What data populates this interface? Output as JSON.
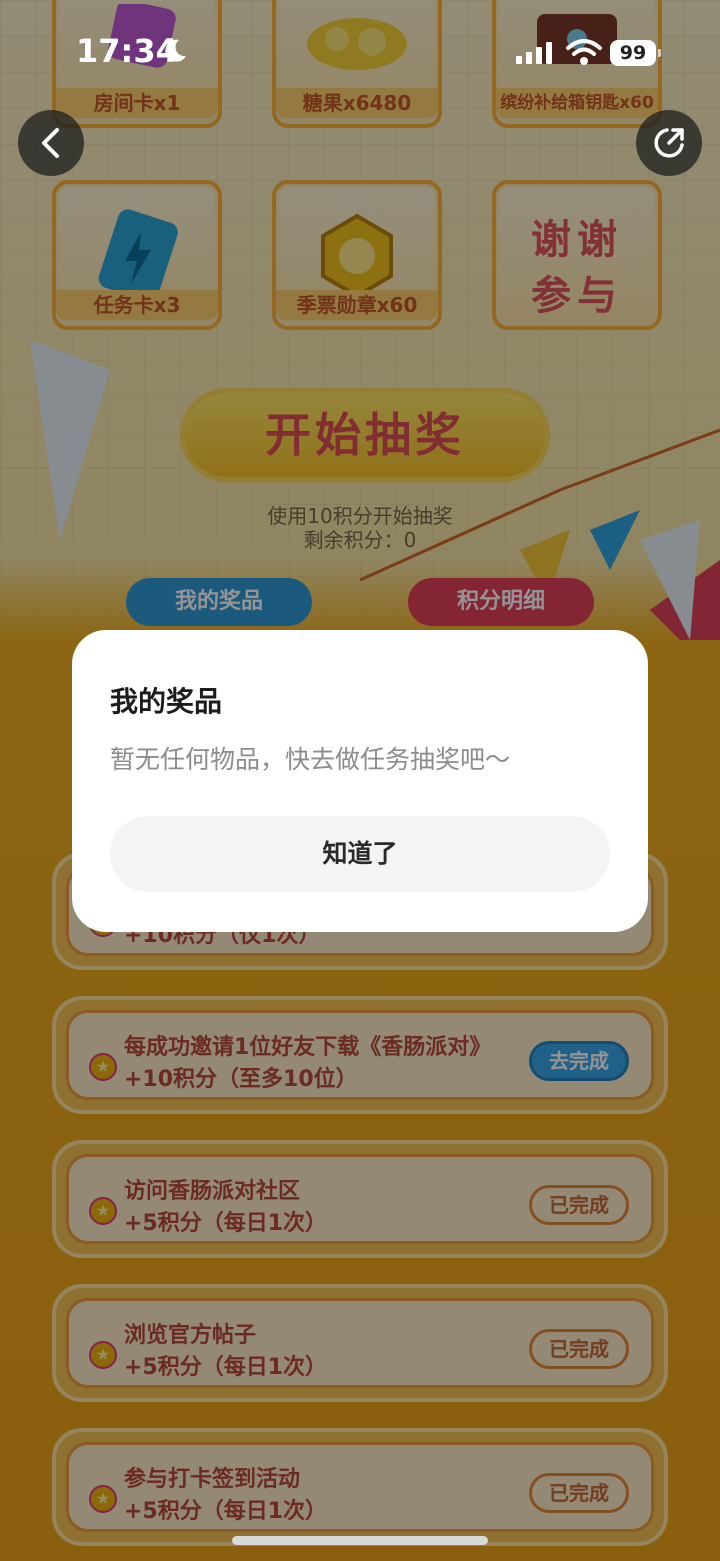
{
  "status_bar": {
    "time": "17:34",
    "battery": "99"
  },
  "prizes": [
    {
      "label": "房间卡x1",
      "icon": "room-card-icon"
    },
    {
      "label": "糖果x6480",
      "icon": "candy-icon"
    },
    {
      "label": "缤纷补给箱钥匙x60",
      "icon": "supply-key-icon"
    },
    {
      "label": "任务卡x3",
      "icon": "task-card-icon"
    },
    {
      "label": "季票勋章x60",
      "icon": "season-medal-icon"
    },
    {
      "label": "谢谢参与",
      "icon": "thanks-text"
    }
  ],
  "draw": {
    "button_label": "开始抽奖",
    "cost_text": "使用10积分开始抽奖",
    "remaining_text": "剩余积分：0"
  },
  "tabs": {
    "my_prizes": "我的奖品",
    "points_detail": "积分明细"
  },
  "tasks": [
    {
      "title": "",
      "points": "+10积分（仅1次）",
      "action": ""
    },
    {
      "title": "每成功邀请1位好友下载《香肠派对》",
      "points": "+10积分（至多10位）",
      "action": "去完成",
      "action_type": "go"
    },
    {
      "title": "访问香肠派对社区",
      "points": "+5积分（每日1次）",
      "action": "已完成",
      "action_type": "done"
    },
    {
      "title": "浏览官方帖子",
      "points": "+5积分（每日1次）",
      "action": "已完成",
      "action_type": "done"
    },
    {
      "title": "参与打卡签到活动",
      "points": "+5积分（每日1次）",
      "action": "已完成",
      "action_type": "done"
    }
  ],
  "dialog": {
    "title": "我的奖品",
    "message": "暂无任何物品，快去做任务抽奖吧～",
    "ok_label": "知道了"
  },
  "colors": {
    "accent_red": "#e04f56",
    "task_go": "#39a7e8",
    "background": "#f1b021"
  }
}
